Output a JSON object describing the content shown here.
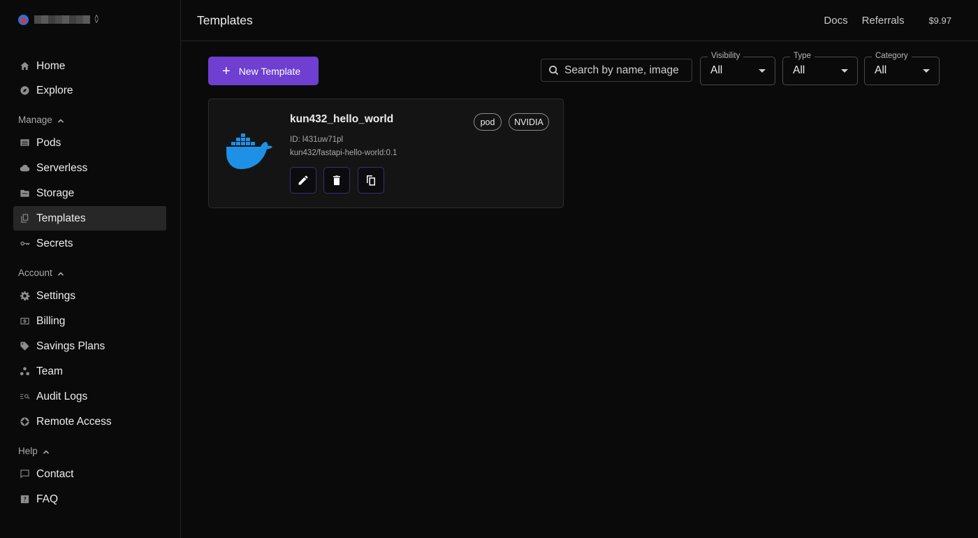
{
  "header": {
    "page_title": "Templates",
    "links": [
      "Docs",
      "Referrals"
    ],
    "balance": "$9.97"
  },
  "sidebar": {
    "top_items": [
      {
        "label": "Home",
        "icon": "home-icon"
      },
      {
        "label": "Explore",
        "icon": "compass-icon"
      }
    ],
    "sections": [
      {
        "title": "Manage",
        "items": [
          {
            "label": "Pods",
            "icon": "pods-icon"
          },
          {
            "label": "Serverless",
            "icon": "cloud-icon"
          },
          {
            "label": "Storage",
            "icon": "folder-icon"
          },
          {
            "label": "Templates",
            "icon": "copy-icon",
            "active": true
          },
          {
            "label": "Secrets",
            "icon": "key-icon"
          }
        ]
      },
      {
        "title": "Account",
        "items": [
          {
            "label": "Settings",
            "icon": "gear-icon"
          },
          {
            "label": "Billing",
            "icon": "dollar-icon"
          },
          {
            "label": "Savings Plans",
            "icon": "tag-icon"
          },
          {
            "label": "Team",
            "icon": "team-icon"
          },
          {
            "label": "Audit Logs",
            "icon": "audit-icon"
          },
          {
            "label": "Remote Access",
            "icon": "remote-icon"
          }
        ]
      },
      {
        "title": "Help",
        "items": [
          {
            "label": "Contact",
            "icon": "chat-icon"
          },
          {
            "label": "FAQ",
            "icon": "question-icon"
          }
        ]
      }
    ]
  },
  "toolbar": {
    "new_template_label": "New Template",
    "search_placeholder": "Search by name, image",
    "filters": [
      {
        "legend": "Visibility",
        "value": "All"
      },
      {
        "legend": "Type",
        "value": "All"
      },
      {
        "legend": "Category",
        "value": "All"
      }
    ]
  },
  "templates": [
    {
      "name": "kun432_hello_world",
      "id_text": "ID: l431uw71pl",
      "image": "kun432/fastapi-hello-world:0.1",
      "tags": [
        "pod",
        "NVIDIA"
      ]
    }
  ],
  "colors": {
    "accent": "#6e3fd1",
    "docker_blue": "#1d91e6",
    "background": "#0a0a0a"
  }
}
